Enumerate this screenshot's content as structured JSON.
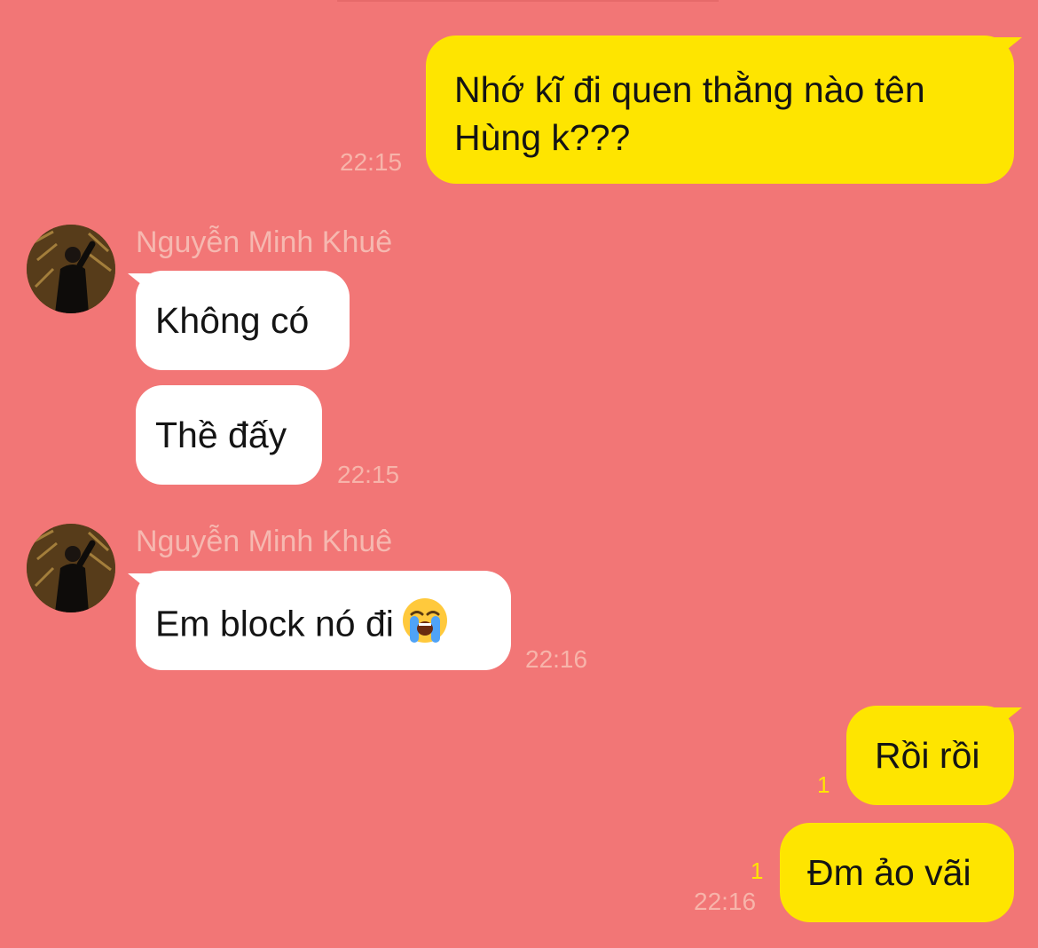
{
  "chat": {
    "sender_name": "Nguyễn Minh Khuê",
    "messages": [
      {
        "id": "m1",
        "from": "me",
        "text": "Nhớ kĩ đi quen thằng nào tên Hùng k???",
        "line1": "Nhớ kĩ đi quen thằng nào tên",
        "line2": "Hùng k???",
        "time": "22:15"
      },
      {
        "id": "m2",
        "from": "them",
        "text": "Không có"
      },
      {
        "id": "m3",
        "from": "them",
        "text": "Thề đấy",
        "time": "22:15"
      },
      {
        "id": "m4",
        "from": "them",
        "text": "Em block nó đi",
        "emoji": "loudly-crying-face",
        "time": "22:16"
      },
      {
        "id": "m5",
        "from": "me",
        "text": "Rồi rồi",
        "unread": "1"
      },
      {
        "id": "m6",
        "from": "me",
        "text": "Đm ảo vãi",
        "unread": "1",
        "time": "22:16"
      }
    ]
  },
  "colors": {
    "background": "#F27676",
    "my_bubble": "#FEE500",
    "their_bubble": "#FFFFFF",
    "meta_text": "#F7B4AA",
    "unread_count": "#FEE500"
  }
}
